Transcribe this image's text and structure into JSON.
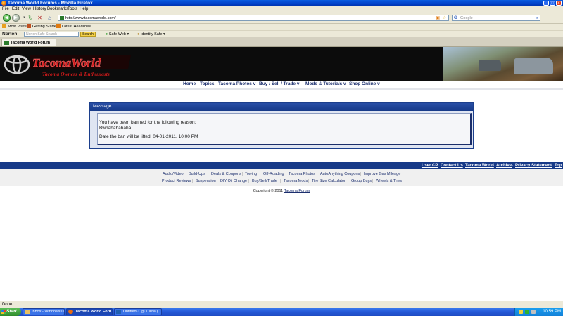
{
  "window": {
    "title": "Tacoma World Forums - Mozilla Firefox"
  },
  "menu": [
    "File",
    "Edit",
    "View",
    "History",
    "Bookmarks",
    "Tools",
    "Help"
  ],
  "address": {
    "url": "http://www.tacomaworld.com/",
    "search_placeholder": "Google"
  },
  "bookmarks": [
    "Most Visited",
    "Getting Started",
    "Latest Headlines"
  ],
  "norton": {
    "brand": "Norton",
    "search_placeholder": "Norton Safe Search",
    "search_button": "Search",
    "safe_web": "Safe Web",
    "identity_safe": "Identity Safe"
  },
  "tab": {
    "title": "Tacoma World Forum"
  },
  "site": {
    "logo_text": "TacomaWorld",
    "logo_tagline": "Tacoma Owners & Enthusiasts",
    "nav": [
      "Home",
      "Topics",
      "Tacoma Photos v",
      "Buy / Sell / Trade v",
      "Mods & Tutorials v",
      "Shop Online v"
    ]
  },
  "message": {
    "header": "Message",
    "line1": "You have been banned for the following reason:",
    "line2": "Bwhahahahaha",
    "line3": "Date the ban will be lifted: 04-01-2011, 10:00 PM"
  },
  "footer": {
    "top_links": [
      "User CP",
      "Contact Us",
      "Tacoma World",
      "Archive",
      "Privacy Statement",
      "Top"
    ],
    "row1": [
      "Audio/Video",
      "Build-Ups",
      "Deals & Coupons",
      "Towing",
      "Off-Roading",
      "Tacoma Photos",
      "AutoAnything Coupons",
      "Improve Gas Mileage"
    ],
    "row2": [
      "Product Reviews",
      "Suspension",
      "DIY Oil Change",
      "Buy/Sell/Trade",
      "Tacoma Mods",
      "Tire Size Calculator",
      "Group Buys",
      "Wheels & Tires"
    ],
    "copyright_prefix": "Copyright © 2011",
    "copyright_link": "Tacoma Forum"
  },
  "status": {
    "text": "Done"
  },
  "taskbar": {
    "start": "Start",
    "tasks": [
      "Inbox - Windows Live...",
      "Tacoma World Foru...",
      "Untitled-1 @ 100% (..."
    ],
    "clock": "10:59 PM"
  }
}
